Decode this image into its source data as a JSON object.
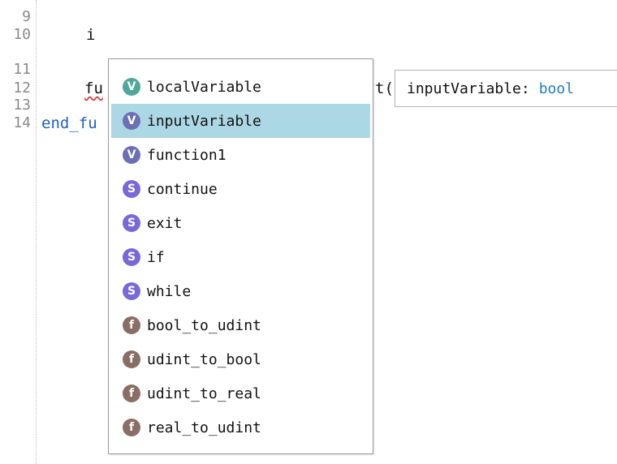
{
  "editor": {
    "line_numbers": [
      "9",
      "10",
      "11",
      "12",
      "13",
      "14"
    ],
    "lines": {
      "l10": "i",
      "l12_a": "fu",
      "l12_b": "t(",
      "l14": "end_fu"
    }
  },
  "autocomplete": {
    "items": [
      {
        "label": "localVariable",
        "icon_letter": "V",
        "icon": "variable-icon",
        "color": "#4fa89a"
      },
      {
        "label": "inputVariable",
        "icon_letter": "V",
        "icon": "variable-icon",
        "color": "#6b6fb6"
      },
      {
        "label": "function1",
        "icon_letter": "V",
        "icon": "variable-icon",
        "color": "#6b6fb6"
      },
      {
        "label": "continue",
        "icon_letter": "S",
        "icon": "snippet-icon",
        "color": "#7868d8"
      },
      {
        "label": "exit",
        "icon_letter": "S",
        "icon": "snippet-icon",
        "color": "#7868d8"
      },
      {
        "label": "if",
        "icon_letter": "S",
        "icon": "snippet-icon",
        "color": "#7868d8"
      },
      {
        "label": "while",
        "icon_letter": "S",
        "icon": "snippet-icon",
        "color": "#7868d8"
      },
      {
        "label": "bool_to_udint",
        "icon_letter": "f",
        "icon": "function-icon",
        "color": "#8a6e66"
      },
      {
        "label": "udint_to_bool",
        "icon_letter": "f",
        "icon": "function-icon",
        "color": "#8a6e66"
      },
      {
        "label": "udint_to_real",
        "icon_letter": "f",
        "icon": "function-icon",
        "color": "#8a6e66"
      },
      {
        "label": "real_to_udint",
        "icon_letter": "f",
        "icon": "function-icon",
        "color": "#8a6e66"
      }
    ],
    "selected_index": 1,
    "selected_color": "#acd8e5"
  },
  "tooltip": {
    "name": "inputVariable:",
    "type": "bool"
  }
}
